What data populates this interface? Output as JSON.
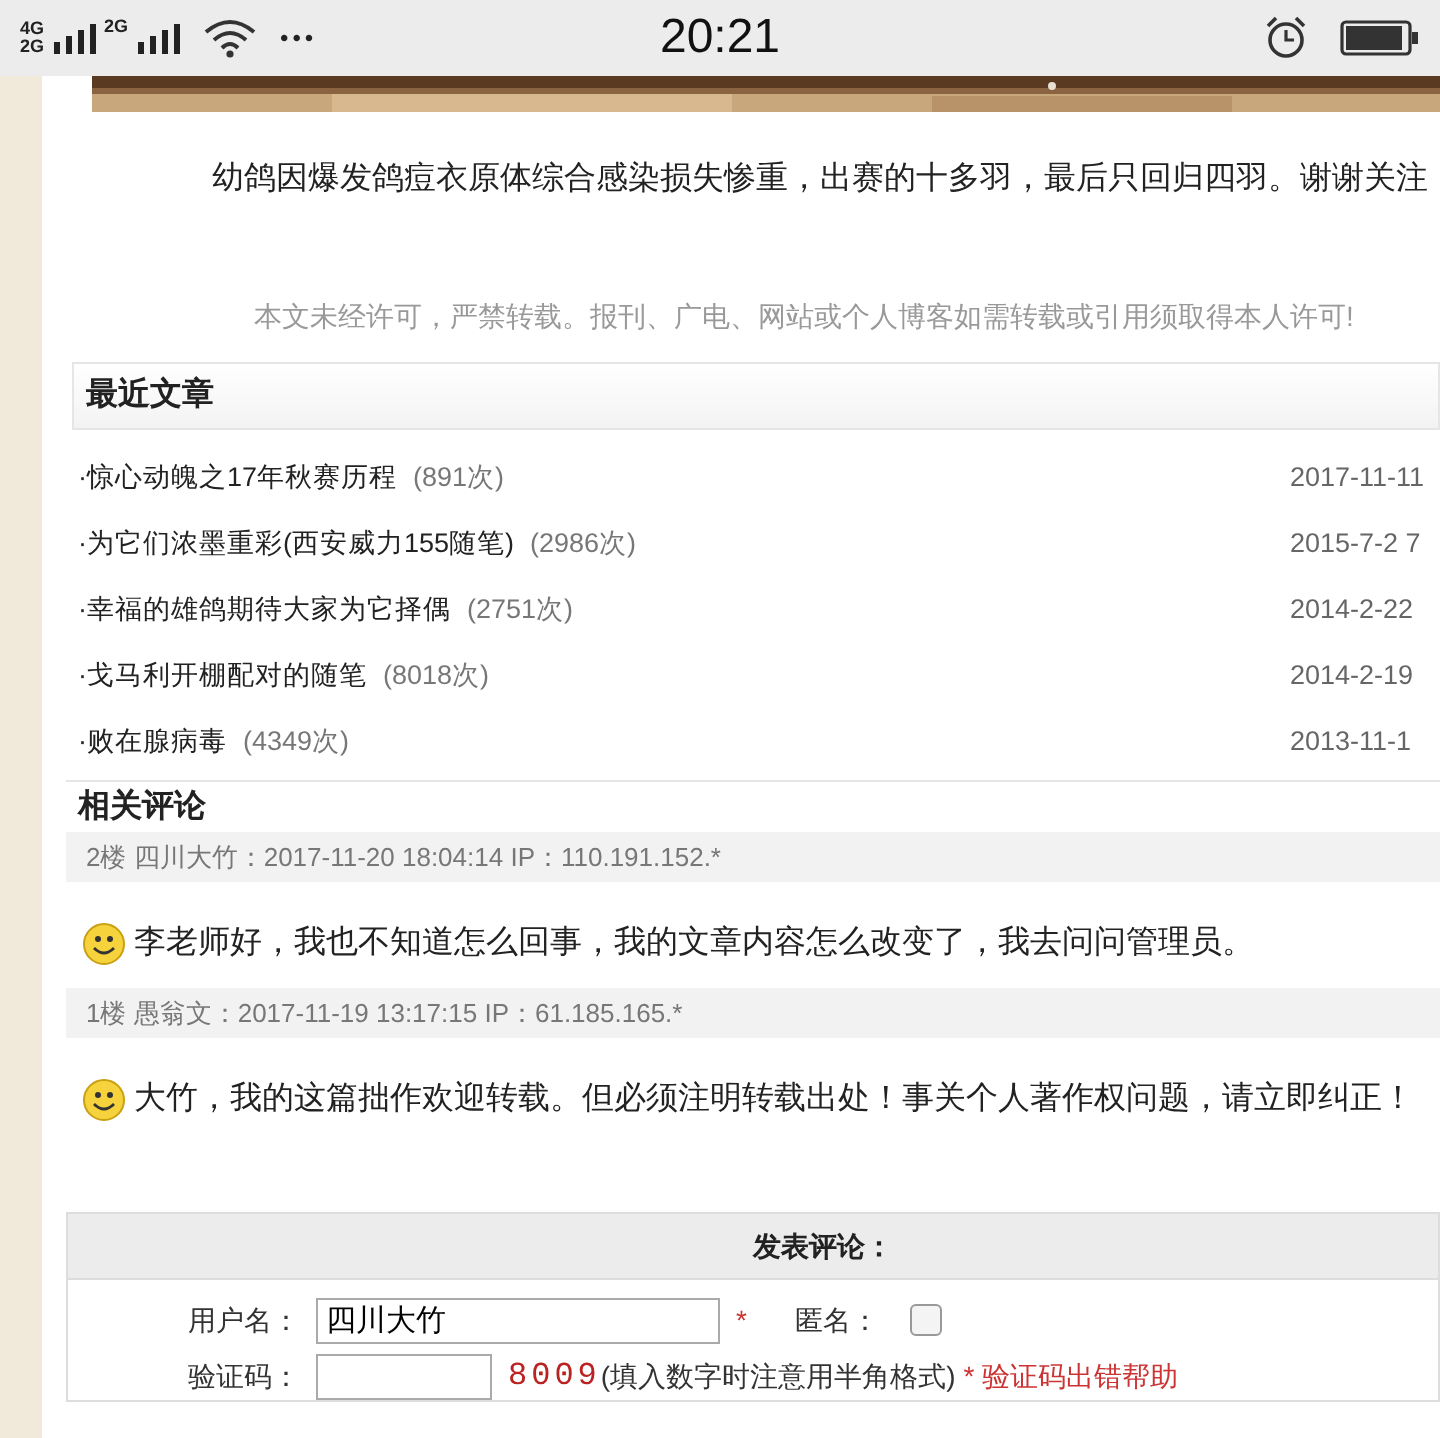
{
  "status_bar": {
    "network_labels": [
      "4G",
      "2G",
      "2G"
    ],
    "more": "•••",
    "time": "20:21"
  },
  "article": {
    "paragraph": "幼鸽因爆发鸽痘衣原体综合感染损失惨重，出赛的十多羽，最后只回归四羽。谢谢关注",
    "copyright": "本文未经许可，严禁转载。报刊、广电、网站或个人博客如需转载或引用须取得本人许可!"
  },
  "recent_articles": {
    "title": "最近文章",
    "items": [
      {
        "title": "·惊心动魄之17年秋赛历程",
        "views": "(891次)",
        "date": "2017-11-11"
      },
      {
        "title": "·为它们浓墨重彩(西安威力155随笔)",
        "views": "(2986次)",
        "date": "2015-7-2 7"
      },
      {
        "title": "·幸福的雄鸽期待大家为它择偶",
        "views": "(2751次)",
        "date": "2014-2-22"
      },
      {
        "title": "·戈马利开棚配对的随笔",
        "views": "(8018次)",
        "date": "2014-2-19"
      },
      {
        "title": "·败在腺病毒",
        "views": "(4349次)",
        "date": "2013-11-1"
      }
    ]
  },
  "comments": {
    "title": "相关评论",
    "items": [
      {
        "meta": "2楼  四川大竹：2017-11-20 18:04:14 IP：110.191.152.*",
        "text": "李老师好，我也不知道怎么回事，我的文章内容怎么改变了，我去问问管理员。"
      },
      {
        "meta": "1楼  愚翁文：2017-11-19 13:17:15 IP：61.185.165.*",
        "text": "大竹，我的这篇拙作欢迎转载。但必须注明转载出处！事关个人著作权问题，请立即纠正！"
      }
    ]
  },
  "comment_form": {
    "title": "发表评论：",
    "username_label": "用户名：",
    "username": "四川大竹",
    "required_mark": "*",
    "anonymous_label": "匿名：",
    "anonymous": false,
    "captcha_label": "验证码：",
    "captcha_code": "8009",
    "captcha_hint": "(填入数字时注意用半角格式)",
    "captcha_help": "* 验证码出错帮助"
  }
}
